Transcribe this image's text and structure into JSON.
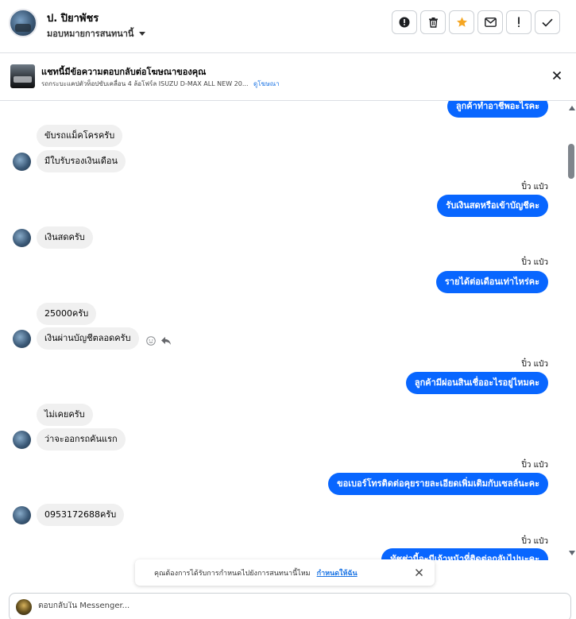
{
  "header": {
    "contact_name": "ป. ปิยาพัชร",
    "assign_label": "มอบหมายการสนทนานี้",
    "buttons": [
      {
        "name": "mark-spam-button",
        "icon": "alert-circle-icon"
      },
      {
        "name": "delete-button",
        "icon": "trash-icon"
      },
      {
        "name": "star-button",
        "icon": "star-icon",
        "color": "#f5a623"
      },
      {
        "name": "mark-unread-button",
        "icon": "envelope-icon"
      },
      {
        "name": "follow-up-button",
        "icon": "exclamation-icon"
      },
      {
        "name": "mark-done-button",
        "icon": "check-icon"
      }
    ]
  },
  "ad_banner": {
    "title": "แชทนี้มีข้อความตอบกลับต่อโฆษณาของคุณ",
    "subtitle": "รถกระบะแคปตัวท็อปขับเคลื่อน 4 ล้อโฟร์ล ISUZU D-MAX ALL NEW 20...",
    "link": "ดูโฆษณา"
  },
  "messages": {
    "m1_out": "ลูกค้าทำอาชีพอะไรคะ",
    "m2_in": "ขับรถแม็คโครครับ",
    "m3_in": "มีใบรับรองเงินเดือน",
    "m4_sender": "ปิ๋ว แป๋ว",
    "m4_out": "รับเงินสดหรือเข้าบัญชีคะ",
    "m5_in": "เงินสดครับ",
    "m6_sender": "ปิ๋ว แป๋ว",
    "m6_out": "รายได้ต่อเดือนเท่าไหร่คะ",
    "m7_in": "25000ครับ",
    "m8_in": "เงินผ่านบัญชีตลอดครับ",
    "m9_sender": "ปิ๋ว แป๋ว",
    "m9_out": "ลูกค้ามีผ่อนสินเชื่ออะไรอยู่ไหมคะ",
    "m10_in": "ไม่เคยครับ",
    "m11_in": "ว่าจะออกรถคันแรก",
    "m12_sender": "ปิ๋ว แป๋ว",
    "m12_out": "ขอเบอร์โทรติดต่อคุยรายละเอียดเพิ่มเติมกับเซลล์นะคะ",
    "m13_in": "0953172688ครับ",
    "m14_sender": "ปิ๋ว แป๋ว",
    "m14_out": "ทัชช่วนี้จะมีเจ้าหน้าที่ติดต่อกลับไปนะคะ"
  },
  "toast": {
    "text": "คุณต้องการได้รับการกำหนดไปยังการสนทนานี้ไหม",
    "link": "กำหนดให้ฉัน"
  },
  "composer": {
    "placeholder": "ตอบกลับใน Messenger..."
  },
  "colors": {
    "outgoing_bubble": "#0866ff",
    "incoming_bubble": "#f0f0f0",
    "link": "#1b74e4",
    "star": "#f5a623"
  }
}
